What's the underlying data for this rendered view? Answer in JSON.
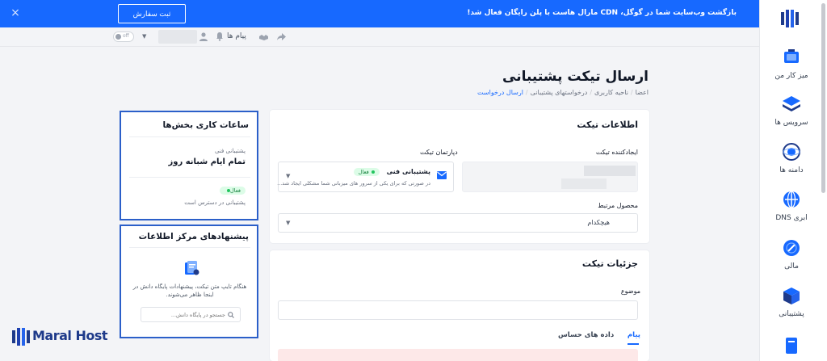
{
  "announcement": {
    "message": "بازگشت وب‌سایت شما در گوگل، CDN مارال هاست با پلن رایگان فعال شد!",
    "button_label": "ثبت سفارش",
    "close_symbol": "×"
  },
  "toolbar": {
    "toggle_label": "off",
    "messages_label": "پیام ها"
  },
  "sidebar": {
    "items": [
      {
        "label": "میز کار من",
        "icon": "desk-icon"
      },
      {
        "label": "سرویس ها",
        "icon": "layers-icon"
      },
      {
        "label": "دامنه ها",
        "icon": "globe-icon"
      },
      {
        "label": "DNS ابری",
        "icon": "dns-icon"
      },
      {
        "label": "مالی",
        "icon": "wallet-icon"
      },
      {
        "label": "پشتیبانی",
        "icon": "support-box-icon"
      }
    ]
  },
  "page": {
    "title": "ارسال تیکت پشتیبانی",
    "breadcrumb": [
      "اعضا",
      "ناحیه کاربری",
      "درخواستهای پشتیبانی",
      "ارسال درخواست"
    ]
  },
  "ticket_info": {
    "title": "اطلاعات تیکت",
    "creator_label": "ایجادکننده تیکت",
    "department_label": "دپارتمان تیکت",
    "department": {
      "name": "پشتیبانی فنی",
      "status": "فعال",
      "description": "در صورتی که برای یکی از سرور های میزبانی شما مشکلی ایجاد شد..."
    },
    "product_label": "محصول مرتبط",
    "product_value": "هیچکدام"
  },
  "ticket_details": {
    "title": "جزئیات تیکت",
    "subject_label": "موضوع",
    "tabs": [
      "پیام",
      "داده های حساس"
    ]
  },
  "working_hours": {
    "title": "ساعات کاری بخش‌ها",
    "department": "پشتیبانی فنی",
    "hours": "تمام ایام شبانه روز",
    "status": "فعال",
    "availability": "پشتیبانی در دسترس است"
  },
  "kb_suggestions": {
    "title": "پیشنهادهای مرکز اطلاعات",
    "hint": "هنگام تایپ متن تیکت، پیشنهادات پایگاه دانش در اینجا ظاهر می‌شوند.",
    "search_placeholder": "جستجو در پایگاه دانش..."
  },
  "brand": {
    "name": "Maral Host"
  },
  "colors": {
    "primary": "#1769ff",
    "highlight_border": "#2b5fc9",
    "success": "#22c55e"
  }
}
